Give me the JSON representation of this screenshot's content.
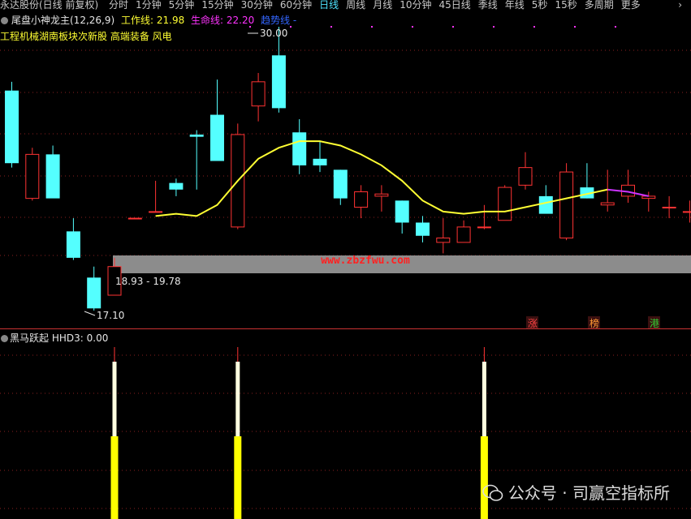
{
  "toolbar": {
    "stock_title": "永达股份(日线 前复权)",
    "periods": [
      "分时",
      "1分钟",
      "5分钟",
      "15分钟",
      "30分钟",
      "60分钟",
      "日线",
      "周线",
      "月线",
      "10分钟",
      "45日线",
      "季线",
      "年线",
      "5秒",
      "15秒",
      "多周期",
      "更多"
    ],
    "active_period": "日线",
    "arrow": "›"
  },
  "indicator": {
    "name": "尾盘小神龙主(12,26,9)",
    "work_label": "工作线: 21.98",
    "life_label": "生命线: 22.20",
    "trend_label": "趋势线 -"
  },
  "concept_text": "工程机械湖南板块次新股 高端装备 风电",
  "price_labels": {
    "high": "30.00",
    "low": "17.10",
    "range": "18.93 - 19.78"
  },
  "watermark_text": "www.zbzfwu.com",
  "sub_indicator": {
    "name": "黑马跃起",
    "value": "HHD3: 0.00"
  },
  "tags": [
    "涨",
    "榜",
    "港"
  ],
  "footer_watermark": "公众号 · 司赢空指标所",
  "colors": {
    "up": "#ff3333",
    "down": "#54ffff",
    "line": "#ffff33",
    "purple": "#cc33ff",
    "band": "#8c8c8c",
    "bar": "#ffff00"
  },
  "chart_data": {
    "type": "candlestick",
    "price_range": [
      17.1,
      30.0
    ],
    "candles": [
      {
        "o": 27.1,
        "h": 27.5,
        "l": 23.6,
        "c": 23.8
      },
      {
        "o": 22.2,
        "h": 24.5,
        "l": 22.1,
        "c": 24.2
      },
      {
        "o": 24.2,
        "h": 24.6,
        "l": 22.3,
        "c": 22.2
      },
      {
        "o": 20.7,
        "h": 21.3,
        "l": 19.4,
        "c": 19.5
      },
      {
        "o": 18.6,
        "h": 19.1,
        "l": 17.1,
        "c": 17.2
      },
      {
        "o": 17.8,
        "h": 19.5,
        "l": 17.8,
        "c": 19.1
      },
      {
        "o": 21.3,
        "h": 21.3,
        "l": 21.3,
        "c": 21.3
      },
      {
        "o": 21.6,
        "h": 23.0,
        "l": 21.6,
        "c": 21.6
      },
      {
        "o": 22.9,
        "h": 23.1,
        "l": 22.3,
        "c": 22.6
      },
      {
        "o": 25.1,
        "h": 25.3,
        "l": 22.6,
        "c": 25.0
      },
      {
        "o": 26.0,
        "h": 27.6,
        "l": 23.9,
        "c": 23.9
      },
      {
        "o": 20.9,
        "h": 25.6,
        "l": 20.8,
        "c": 25.1
      },
      {
        "o": 26.4,
        "h": 27.9,
        "l": 25.7,
        "c": 27.5
      },
      {
        "o": 28.7,
        "h": 30.0,
        "l": 26.1,
        "c": 26.3
      },
      {
        "o": 25.2,
        "h": 25.8,
        "l": 23.3,
        "c": 23.7
      },
      {
        "o": 24.0,
        "h": 24.8,
        "l": 23.4,
        "c": 23.7
      },
      {
        "o": 23.5,
        "h": 23.5,
        "l": 21.9,
        "c": 22.2
      },
      {
        "o": 21.8,
        "h": 22.8,
        "l": 21.3,
        "c": 22.5
      },
      {
        "o": 22.3,
        "h": 22.8,
        "l": 21.6,
        "c": 22.4
      },
      {
        "o": 22.1,
        "h": 22.1,
        "l": 20.6,
        "c": 21.1
      },
      {
        "o": 21.1,
        "h": 21.4,
        "l": 20.2,
        "c": 20.5
      },
      {
        "o": 20.2,
        "h": 21.3,
        "l": 19.7,
        "c": 20.4
      },
      {
        "o": 20.2,
        "h": 21.2,
        "l": 20.2,
        "c": 20.9
      },
      {
        "o": 20.9,
        "h": 21.9,
        "l": 20.8,
        "c": 20.9
      },
      {
        "o": 21.2,
        "h": 22.8,
        "l": 21.2,
        "c": 22.7
      },
      {
        "o": 22.8,
        "h": 24.3,
        "l": 22.6,
        "c": 23.6
      },
      {
        "o": 22.3,
        "h": 22.8,
        "l": 21.8,
        "c": 21.5
      },
      {
        "o": 20.4,
        "h": 23.8,
        "l": 20.3,
        "c": 23.4
      },
      {
        "o": 22.7,
        "h": 23.8,
        "l": 22.2,
        "c": 22.2
      },
      {
        "o": 21.9,
        "h": 23.5,
        "l": 21.6,
        "c": 22.0
      },
      {
        "o": 22.3,
        "h": 23.5,
        "l": 22.0,
        "c": 22.8
      },
      {
        "o": 22.2,
        "h": 22.5,
        "l": 21.6,
        "c": 22.3
      },
      {
        "o": 21.8,
        "h": 22.3,
        "l": 21.3,
        "c": 21.8
      },
      {
        "o": 21.6,
        "h": 22.1,
        "l": 21.1,
        "c": 21.6
      }
    ],
    "line": [
      null,
      null,
      null,
      null,
      null,
      null,
      null,
      21.4,
      21.5,
      21.4,
      21.9,
      23.0,
      24.0,
      24.5,
      24.8,
      24.8,
      24.6,
      24.2,
      23.7,
      23.0,
      22.1,
      21.6,
      21.5,
      21.6,
      21.6,
      21.8,
      22.0,
      22.2,
      22.4,
      22.6,
      22.5,
      22.3,
      null,
      null
    ],
    "signals": [
      5,
      11,
      23
    ]
  }
}
